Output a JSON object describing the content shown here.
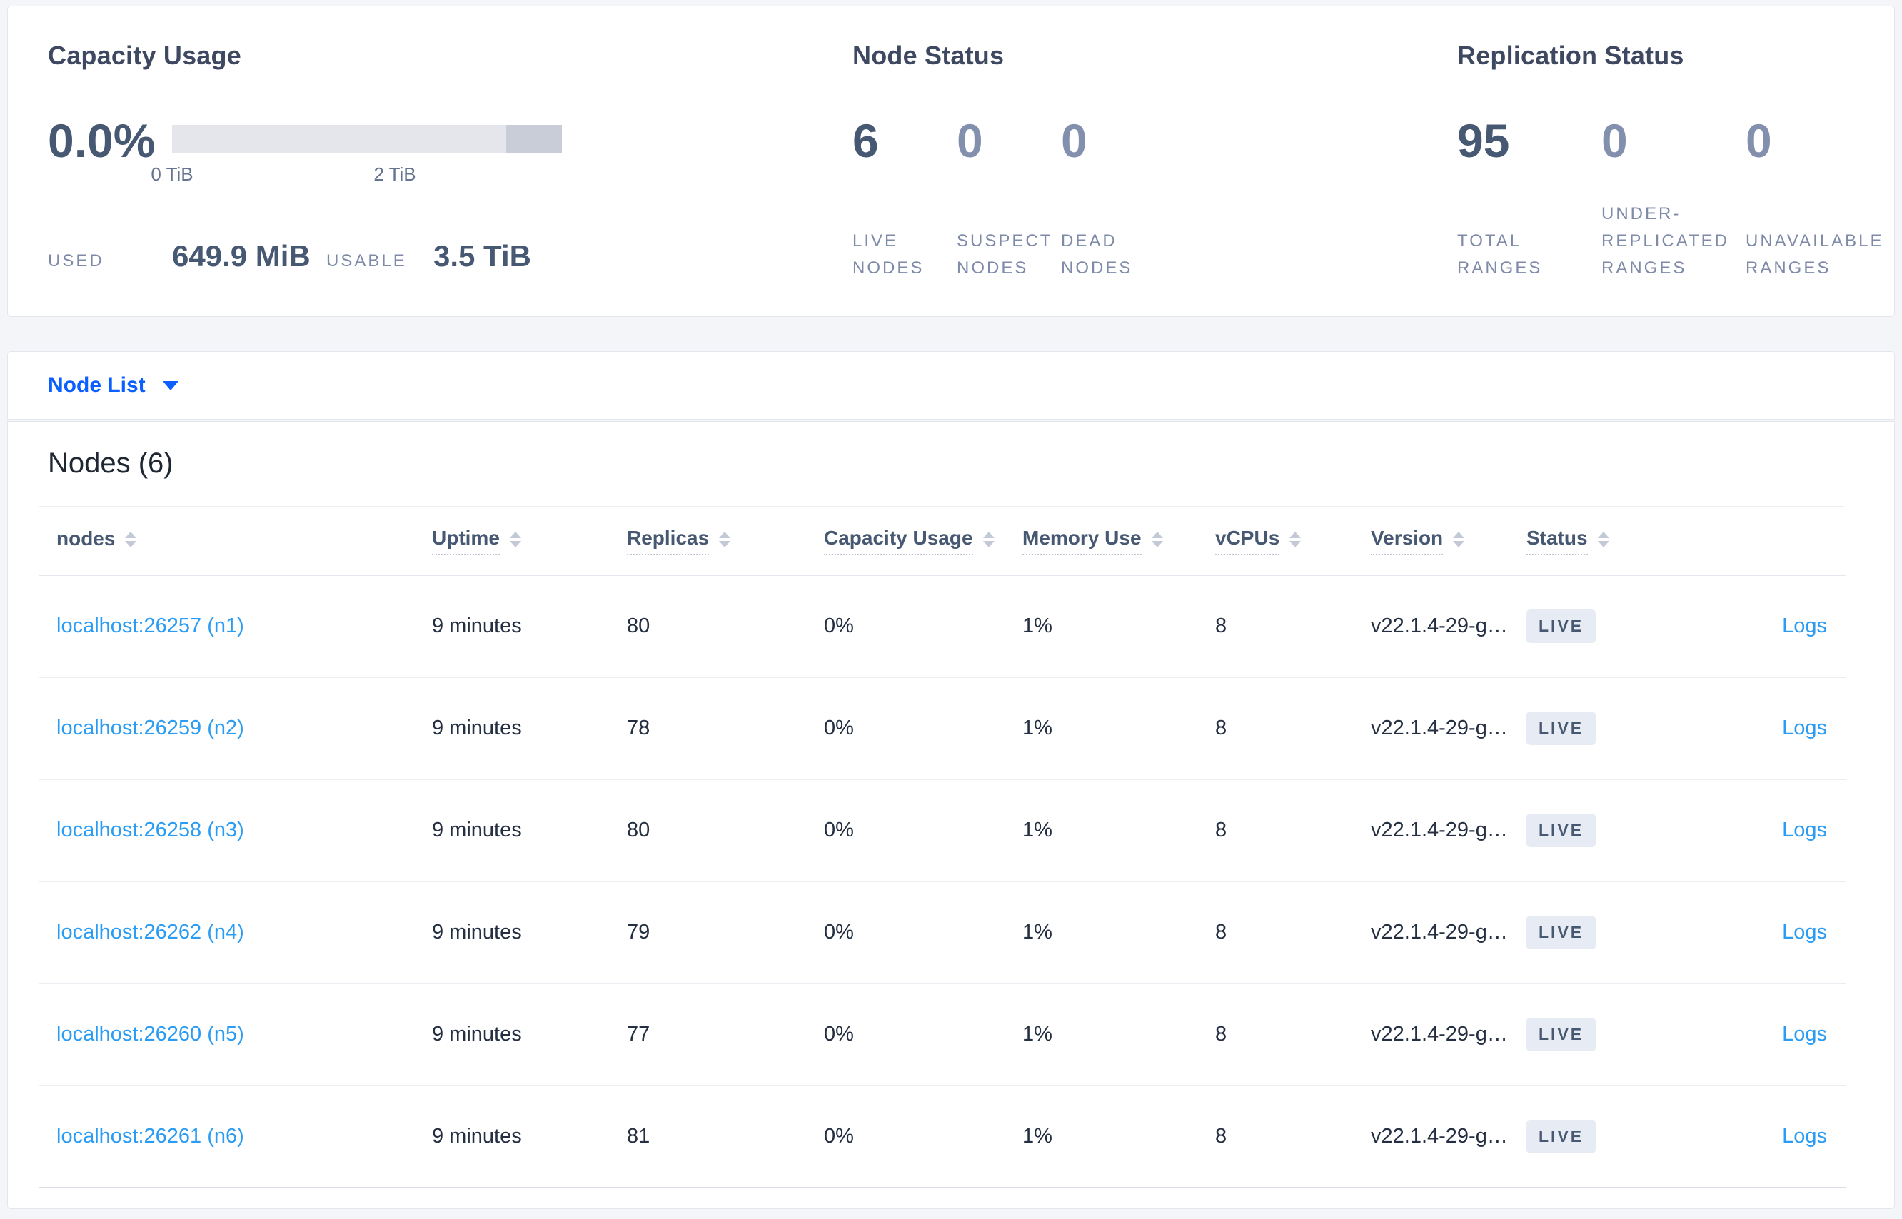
{
  "colors": {
    "accent_blue": "#0b5fff",
    "link_blue": "#2b9cf3",
    "slate": "#475872",
    "muted_label": "#7e8aa8",
    "badge_bg": "#e7ebf3",
    "bar_track": "#e4e6ec",
    "bar_segment": "#c9cdd8"
  },
  "summary": {
    "capacity": {
      "title": "Capacity Usage",
      "percent": "0.0%",
      "used_label": "USED",
      "used_value": "649.9 MiB",
      "usable_label": "USABLE",
      "usable_value": "3.5 TiB",
      "bar": {
        "fill_pct": 0,
        "segment_start_pct": 85.7,
        "segment_end_pct": 100,
        "ticks": [
          {
            "pos_pct": 0,
            "label": "0 TiB"
          },
          {
            "pos_pct": 28.57,
            "label": ""
          },
          {
            "pos_pct": 57.14,
            "label": "2 TiB"
          },
          {
            "pos_pct": 85.71,
            "label": ""
          }
        ]
      }
    },
    "node_status": {
      "title": "Node Status",
      "stats": [
        {
          "value": "6",
          "label": "LIVE NODES",
          "muted": false
        },
        {
          "value": "0",
          "label": "SUSPECT NODES",
          "muted": true
        },
        {
          "value": "0",
          "label": "DEAD NODES",
          "muted": true
        }
      ]
    },
    "replication": {
      "title": "Replication Status",
      "stats": [
        {
          "value": "95",
          "label": "TOTAL RANGES",
          "muted": false
        },
        {
          "value": "0",
          "label": "UNDER-REPLICATED RANGES",
          "muted": true
        },
        {
          "value": "0",
          "label": "UNAVAILABLE RANGES",
          "muted": true
        }
      ]
    }
  },
  "node_list_dropdown": {
    "label": "Node List"
  },
  "nodes_section": {
    "title": "Nodes (6)",
    "columns": [
      {
        "key": "node",
        "label": "nodes",
        "dotted": false
      },
      {
        "key": "uptime",
        "label": "Uptime",
        "dotted": true
      },
      {
        "key": "replicas",
        "label": "Replicas",
        "dotted": true
      },
      {
        "key": "capacity",
        "label": "Capacity Usage",
        "dotted": true
      },
      {
        "key": "memory",
        "label": "Memory Use",
        "dotted": true
      },
      {
        "key": "vcpus",
        "label": "vCPUs",
        "dotted": true
      },
      {
        "key": "version",
        "label": "Version",
        "dotted": true
      },
      {
        "key": "status",
        "label": "Status",
        "dotted": true
      },
      {
        "key": "logs",
        "label": "",
        "dotted": false
      }
    ],
    "rows": [
      {
        "node": "localhost:26257 (n1)",
        "uptime": "9 minutes",
        "replicas": "80",
        "capacity": "0%",
        "memory": "1%",
        "vcpus": "8",
        "version": "v22.1.4-29-g…",
        "status": "LIVE",
        "logs": "Logs"
      },
      {
        "node": "localhost:26259 (n2)",
        "uptime": "9 minutes",
        "replicas": "78",
        "capacity": "0%",
        "memory": "1%",
        "vcpus": "8",
        "version": "v22.1.4-29-g…",
        "status": "LIVE",
        "logs": "Logs"
      },
      {
        "node": "localhost:26258 (n3)",
        "uptime": "9 minutes",
        "replicas": "80",
        "capacity": "0%",
        "memory": "1%",
        "vcpus": "8",
        "version": "v22.1.4-29-g…",
        "status": "LIVE",
        "logs": "Logs"
      },
      {
        "node": "localhost:26262 (n4)",
        "uptime": "9 minutes",
        "replicas": "79",
        "capacity": "0%",
        "memory": "1%",
        "vcpus": "8",
        "version": "v22.1.4-29-g…",
        "status": "LIVE",
        "logs": "Logs"
      },
      {
        "node": "localhost:26260 (n5)",
        "uptime": "9 minutes",
        "replicas": "77",
        "capacity": "0%",
        "memory": "1%",
        "vcpus": "8",
        "version": "v22.1.4-29-g…",
        "status": "LIVE",
        "logs": "Logs"
      },
      {
        "node": "localhost:26261 (n6)",
        "uptime": "9 minutes",
        "replicas": "81",
        "capacity": "0%",
        "memory": "1%",
        "vcpus": "8",
        "version": "v22.1.4-29-g…",
        "status": "LIVE",
        "logs": "Logs"
      }
    ]
  }
}
